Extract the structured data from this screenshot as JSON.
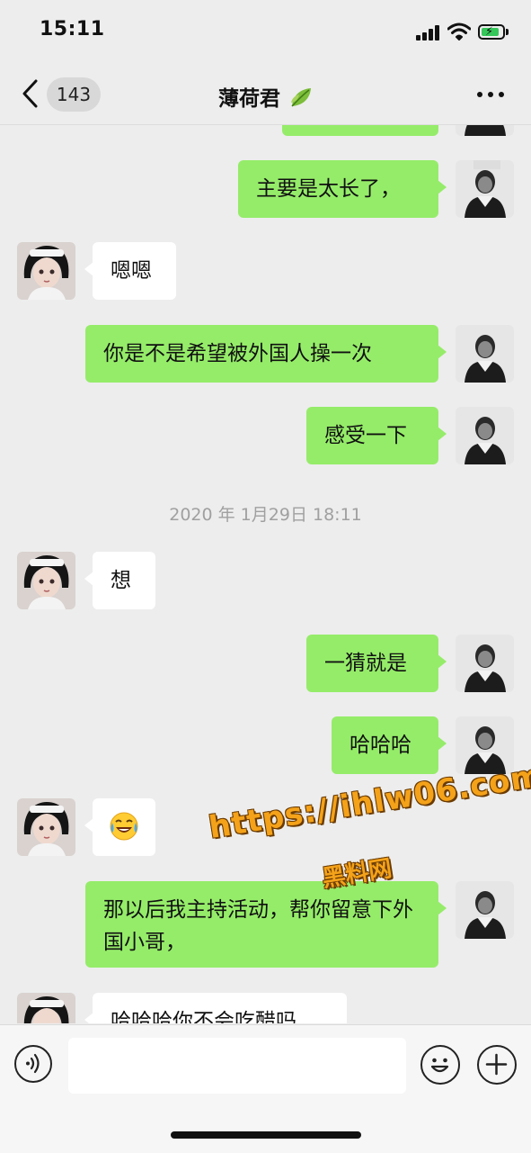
{
  "status": {
    "time": "15:11"
  },
  "nav": {
    "back_badge": "143",
    "title": "薄荷君",
    "title_icon": "leaf-icon"
  },
  "messages": [
    {
      "from": "me",
      "text": "主要是太长了，"
    },
    {
      "from": "her",
      "text": "嗯嗯"
    },
    {
      "from": "me",
      "text": "你是不是希望被外国人操一次"
    },
    {
      "from": "me",
      "text": "感受一下"
    },
    {
      "from": "her",
      "text": "想"
    },
    {
      "from": "me",
      "text": "一猜就是"
    },
    {
      "from": "me",
      "text": "哈哈哈"
    },
    {
      "from": "her",
      "emoji": "crying-laughing-emoji"
    },
    {
      "from": "me",
      "text": "那以后我主持活动，帮你留意下外国小哥，"
    },
    {
      "from": "her",
      "text": "哈哈哈你不会吃醋吗"
    }
  ],
  "timestamp": "2020 年 1月29日 18:11",
  "watermark": {
    "line1": "https://ihlw06.com",
    "line2": "黑料网"
  },
  "colors": {
    "my_bubble": "#95ec69",
    "her_bubble": "#ffffff",
    "background": "#ededed"
  },
  "input_bar": {
    "voice_icon": "voice-icon",
    "emoji_icon": "emoji-icon",
    "plus_icon": "plus-icon"
  }
}
